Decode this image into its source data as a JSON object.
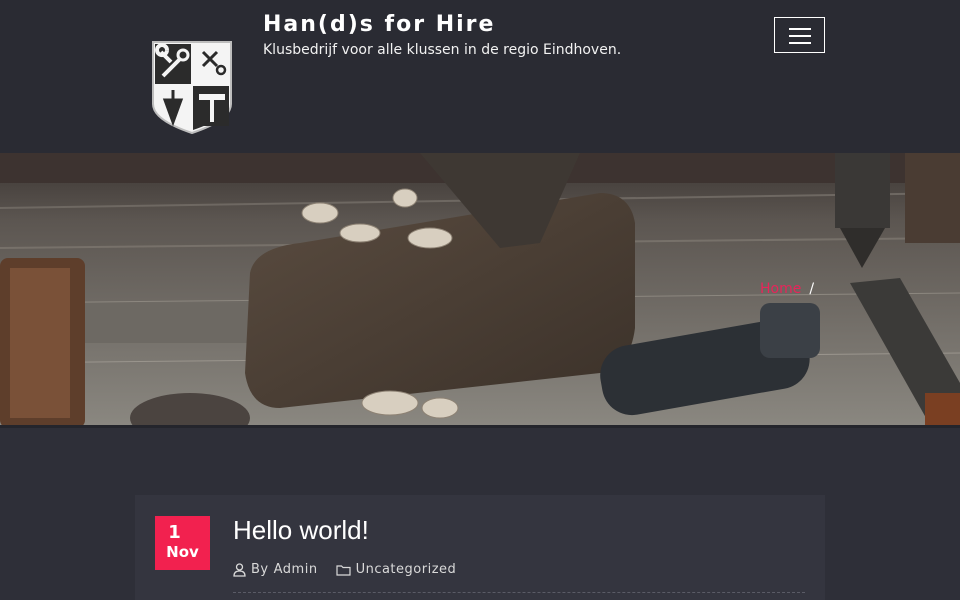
{
  "header": {
    "site_title": "Han(d)s for Hire",
    "tagline": "Klusbedrijf voor alle klussen in de regio Eindhoven.",
    "logo_icon": "shield-tools-logo",
    "menu_icon": "hamburger-menu-icon"
  },
  "banner": {
    "image_description_icon": "woodworking-tools-photo",
    "breadcrumb": {
      "home_label": "Home",
      "separator": "/"
    }
  },
  "post": {
    "date_day": "1",
    "date_month": "Nov",
    "title": "Hello world!",
    "author_prefix": "By",
    "author": "Admin",
    "category": "Uncategorized",
    "author_icon": "user-icon",
    "category_icon": "folder-icon"
  },
  "colors": {
    "accent": "#f2214f",
    "header_bg": "#2a2b33",
    "page_bg": "#2e2f38",
    "card_bg": "#34353f"
  }
}
